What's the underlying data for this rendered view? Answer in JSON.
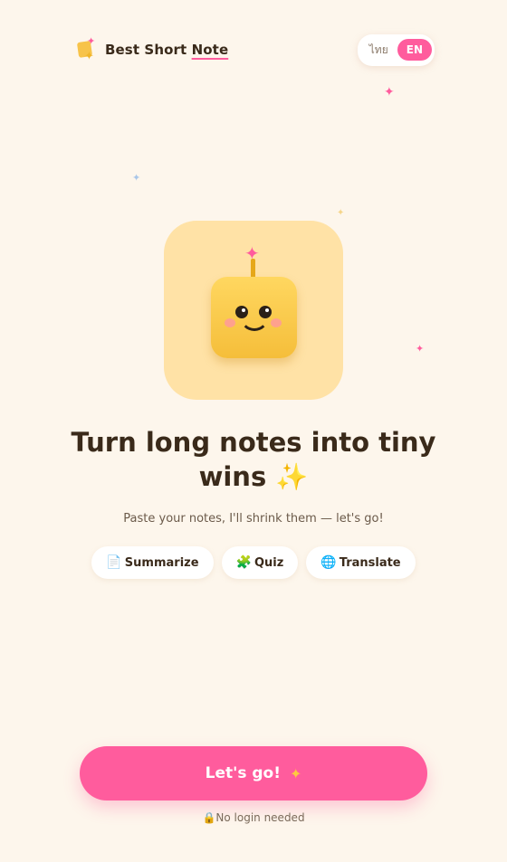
{
  "brand": {
    "name_plain": "Best Short ",
    "name_underlined": "Note"
  },
  "language": {
    "thai": "ไทย",
    "english": "EN",
    "active": "EN"
  },
  "hero": {
    "title": "Turn long notes into tiny wins ✨",
    "subtitle": "Paste your notes, I'll shrink them — let's go!"
  },
  "chips": [
    {
      "icon": "📄",
      "label": "Summarize"
    },
    {
      "icon": "🧩",
      "label": "Quiz"
    },
    {
      "icon": "🌐",
      "label": "Translate"
    }
  ],
  "cta": {
    "label": "Let's go!",
    "star": "✦"
  },
  "footnote": {
    "icon": "🔒",
    "text": "No login needed"
  },
  "colors": {
    "background": "#fdf6ec",
    "accent_pink": "#ff5c9d",
    "tile_yellow": "#ffe2a6",
    "robot_yellow": "#f5be3a",
    "text_dark": "#3a2a1a"
  },
  "icons": {
    "logo": "sticky-note-sparkle-icon",
    "mascot": "robot-mascot",
    "sparkle": "sparkle-icon"
  }
}
